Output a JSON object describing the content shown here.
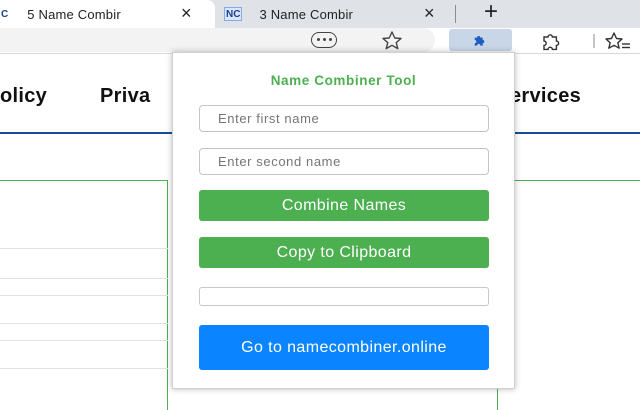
{
  "browser": {
    "tabs": [
      {
        "favicon": "C",
        "title": "5 Name Combir",
        "close": "×"
      },
      {
        "favicon": "NC",
        "title": "3 Name Combir",
        "close": "×"
      }
    ],
    "new_tab": "+"
  },
  "toolbar": {
    "icons": [
      "more-icon",
      "star-icon",
      "extension-icon",
      "puzzle-icon",
      "favorites-icon"
    ]
  },
  "page": {
    "nav": [
      "olicy",
      "Priva",
      "ervices"
    ]
  },
  "popup": {
    "title": "Name Combiner Tool",
    "first_name": {
      "placeholder": "Enter first name",
      "value": ""
    },
    "second_name": {
      "placeholder": "Enter second name",
      "value": ""
    },
    "combine_label": "Combine Names",
    "copy_label": "Copy to Clipboard",
    "result": "",
    "goto_label": "Go to namecombiner.online"
  },
  "colors": {
    "accent_green": "#4caf50",
    "link_blue": "#0a84ff",
    "tabstrip": "#dfe3e8"
  }
}
